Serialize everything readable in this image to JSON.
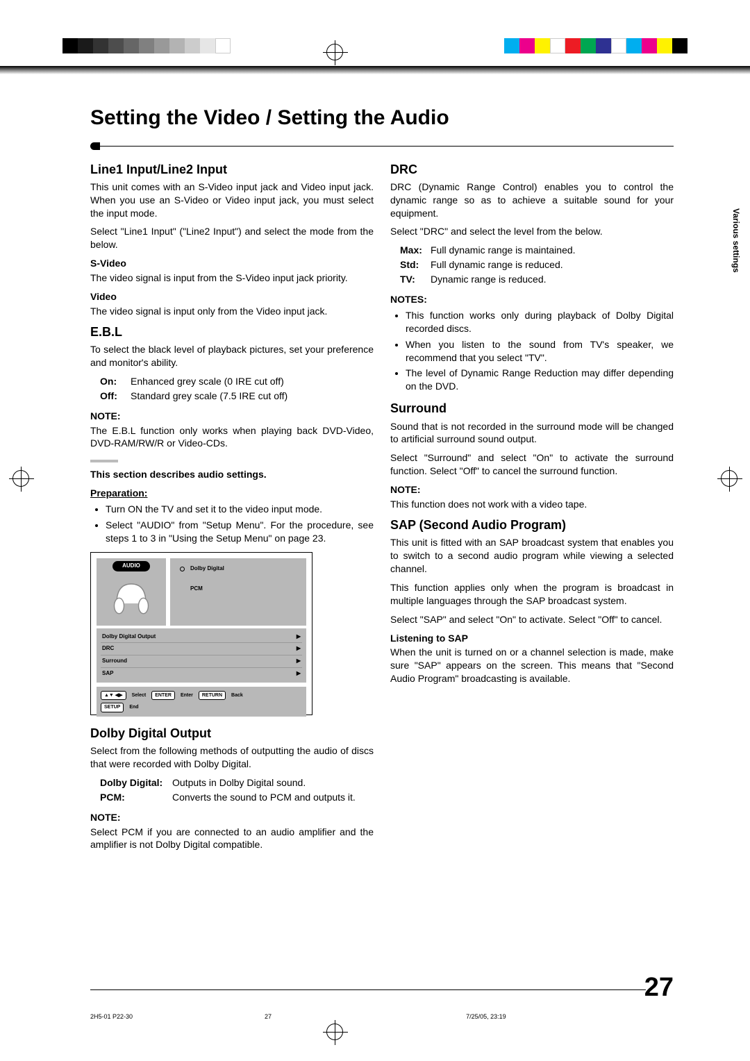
{
  "title": "Setting the Video / Setting the Audio",
  "side_tab": "Various settings",
  "page_number": "27",
  "footer": {
    "file": "2H5-01 P22-30",
    "pg": "27",
    "date": "7/25/05, 23:19"
  },
  "leftcol": {
    "line_input": {
      "heading": "Line1 Input/Line2 Input",
      "p1": "This unit comes with an S-Video input jack and Video input jack. When you use an S-Video or Video input jack, you must select the input mode.",
      "p2": "Select \"Line1 Input\" (\"Line2 Input\") and select the mode from the below.",
      "svideo_h": "S-Video",
      "svideo_p": "The video signal is input from the S-Video input jack priority.",
      "video_h": "Video",
      "video_p": "The video signal is input only from the Video input jack."
    },
    "ebl": {
      "heading": "E.B.L",
      "p1": "To select the black level of playback pictures, set your preference and monitor's ability.",
      "on_k": "On:",
      "on_v": "Enhanced grey scale (0 IRE cut off)",
      "off_k": "Off:",
      "off_v": "Standard grey scale (7.5 IRE cut off)",
      "note_h": "NOTE:",
      "note_p": "The E.B.L function only works when playing back DVD-Video, DVD-RAM/RW/R or Video-CDs."
    },
    "audio_intro": "This section describes audio settings.",
    "prep_h": "Preparation:",
    "prep_items": [
      "Turn ON the TV and set it to the video input mode.",
      "Select \"AUDIO\" from \"Setup Menu\". For the procedure, see steps 1 to 3 in \"Using the Setup Menu\" on page 23."
    ],
    "screen": {
      "label": "AUDIO",
      "opts": [
        "Dolby Digital",
        "PCM"
      ],
      "menu": [
        "Dolby Digital Output",
        "DRC",
        "Surround",
        "SAP"
      ],
      "foot": {
        "select": "Select",
        "enter_btn": "ENTER",
        "enter": "Enter",
        "return_btn": "RETURN",
        "back": "Back",
        "setup_btn": "SETUP",
        "end": "End"
      }
    },
    "dolby": {
      "heading": "Dolby Digital Output",
      "p1": "Select from the following methods of outputting the audio of discs that were recorded with Dolby Digital.",
      "dd_k": "Dolby Digital:",
      "dd_v": "Outputs in Dolby Digital sound.",
      "pcm_k": "PCM:",
      "pcm_v": "Converts the sound to PCM and outputs it.",
      "note_h": "NOTE:",
      "note_p": "Select PCM if you are connected to an audio amplifier and the amplifier is not Dolby Digital compatible."
    }
  },
  "rightcol": {
    "drc": {
      "heading": "DRC",
      "p1": "DRC (Dynamic Range Control) enables you to control the dynamic range so as to achieve a suitable sound for your equipment.",
      "p2": "Select \"DRC\" and select the level from the below.",
      "max_k": "Max:",
      "max_v": "Full dynamic range is maintained.",
      "std_k": "Std:",
      "std_v": "Full dynamic range is reduced.",
      "tv_k": "TV:",
      "tv_v": "Dynamic range is reduced.",
      "notes_h": "NOTES:",
      "notes": [
        "This function works only during playback of Dolby Digital recorded discs.",
        "When you listen to the sound from TV's speaker, we recommend that you select \"TV\".",
        "The level of Dynamic Range Reduction may differ depending on the DVD."
      ]
    },
    "surround": {
      "heading": "Surround",
      "p1": "Sound that is not recorded in the surround mode will be changed to artificial surround sound output.",
      "p2": "Select \"Surround\" and select \"On\" to activate the surround function. Select \"Off\" to cancel the surround function.",
      "note_h": "NOTE:",
      "note_p": "This function does not work with a video tape."
    },
    "sap": {
      "heading": "SAP (Second Audio Program)",
      "p1": "This unit is fitted with an SAP broadcast system that enables you to switch to a second audio program while viewing a selected channel.",
      "p2": "This function applies only when the program is broadcast in multiple languages through the SAP broadcast system.",
      "p3": "Select \"SAP\" and select \"On\" to activate. Select \"Off\" to cancel.",
      "listen_h": "Listening to SAP",
      "listen_p": "When the unit is turned on or a channel selection is made, make sure \"SAP\" appears on the screen. This means that \"Second Audio Program\" broadcasting is available."
    }
  }
}
